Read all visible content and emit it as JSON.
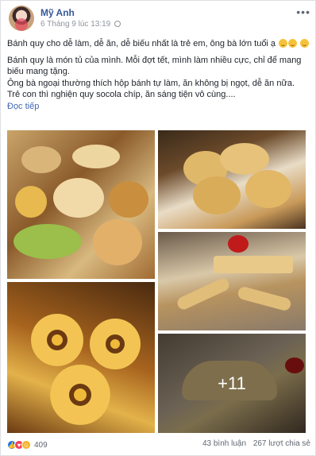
{
  "post": {
    "author": "Mỹ Anh",
    "timestamp": "6 Tháng 9 lúc 13:19",
    "more_label": "•••",
    "paragraphs": [
      "Bánh quy cho dễ làm, dễ ăn, dễ biếu nhất là trẻ em, ông bà lớn tuổi ạ",
      "Bánh quy là món tủ của mình. Mỗi đợt tết, mình làm nhiều cực, chỉ để mang biếu mang tặng.",
      "Ông bà ngoại thường thích hộp bánh tự làm, ăn không bị ngọt, dễ ăn nữa.",
      "Trẻ con thì nghiện quy socola chíp, ăn sáng tiện vô cùng...."
    ],
    "see_more": "Đọc tiếp",
    "photos": {
      "more_count": "+11"
    },
    "reactions": {
      "icons": [
        "like-icon",
        "love-icon",
        "haha-icon"
      ],
      "count": "409"
    },
    "stats": {
      "comments": "43 bình luận",
      "shares": "267 lượt chia sẻ"
    }
  }
}
